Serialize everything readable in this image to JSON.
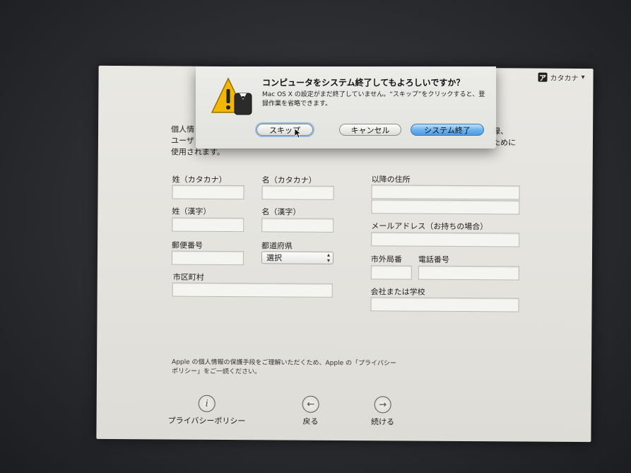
{
  "ime": {
    "label": "カタカナ",
    "icon_char": "ア",
    "caret": "▾"
  },
  "ghost_title": "",
  "intro": {
    "left_text": "個人情\nユーザ\n使用されます。",
    "right_text": "録、\nために"
  },
  "form": {
    "last_kana_label": "姓（カタカナ）",
    "first_kana_label": "名（カタカナ）",
    "last_kanji_label": "姓（漢字）",
    "first_kanji_label": "名（漢字）",
    "postal_label": "郵便番号",
    "prefecture_label": "都道府県",
    "prefecture_value": "選択",
    "city_label": "市区町村",
    "address_label": "以降の住所",
    "email_label": "メールアドレス（お持ちの場合）",
    "area_code_label": "市外局番",
    "phone_label": "電話番号",
    "company_label": "会社または学校"
  },
  "privacy_note": "Apple の個人情報の保護手段をご理解いただくため、Apple の「プライバシーポリシー」をご一読ください。",
  "nav": {
    "privacy_label": "プライバシーポリシー",
    "back_label": "戻る",
    "continue_label": "続ける"
  },
  "dialog": {
    "title": "コンピュータをシステム終了してもよろしいですか？",
    "message": "Mac OS X の設定がまだ終了していません。“スキップ”をクリックすると、登録作業を省略できます。",
    "skip_label": "スキップ",
    "cancel_label": "キャンセル",
    "shutdown_label": "システム終了"
  },
  "colors": {
    "default_button": "#4d9ae3",
    "warning_yellow": "#f2b705",
    "window_bg": "#e5e4df"
  }
}
